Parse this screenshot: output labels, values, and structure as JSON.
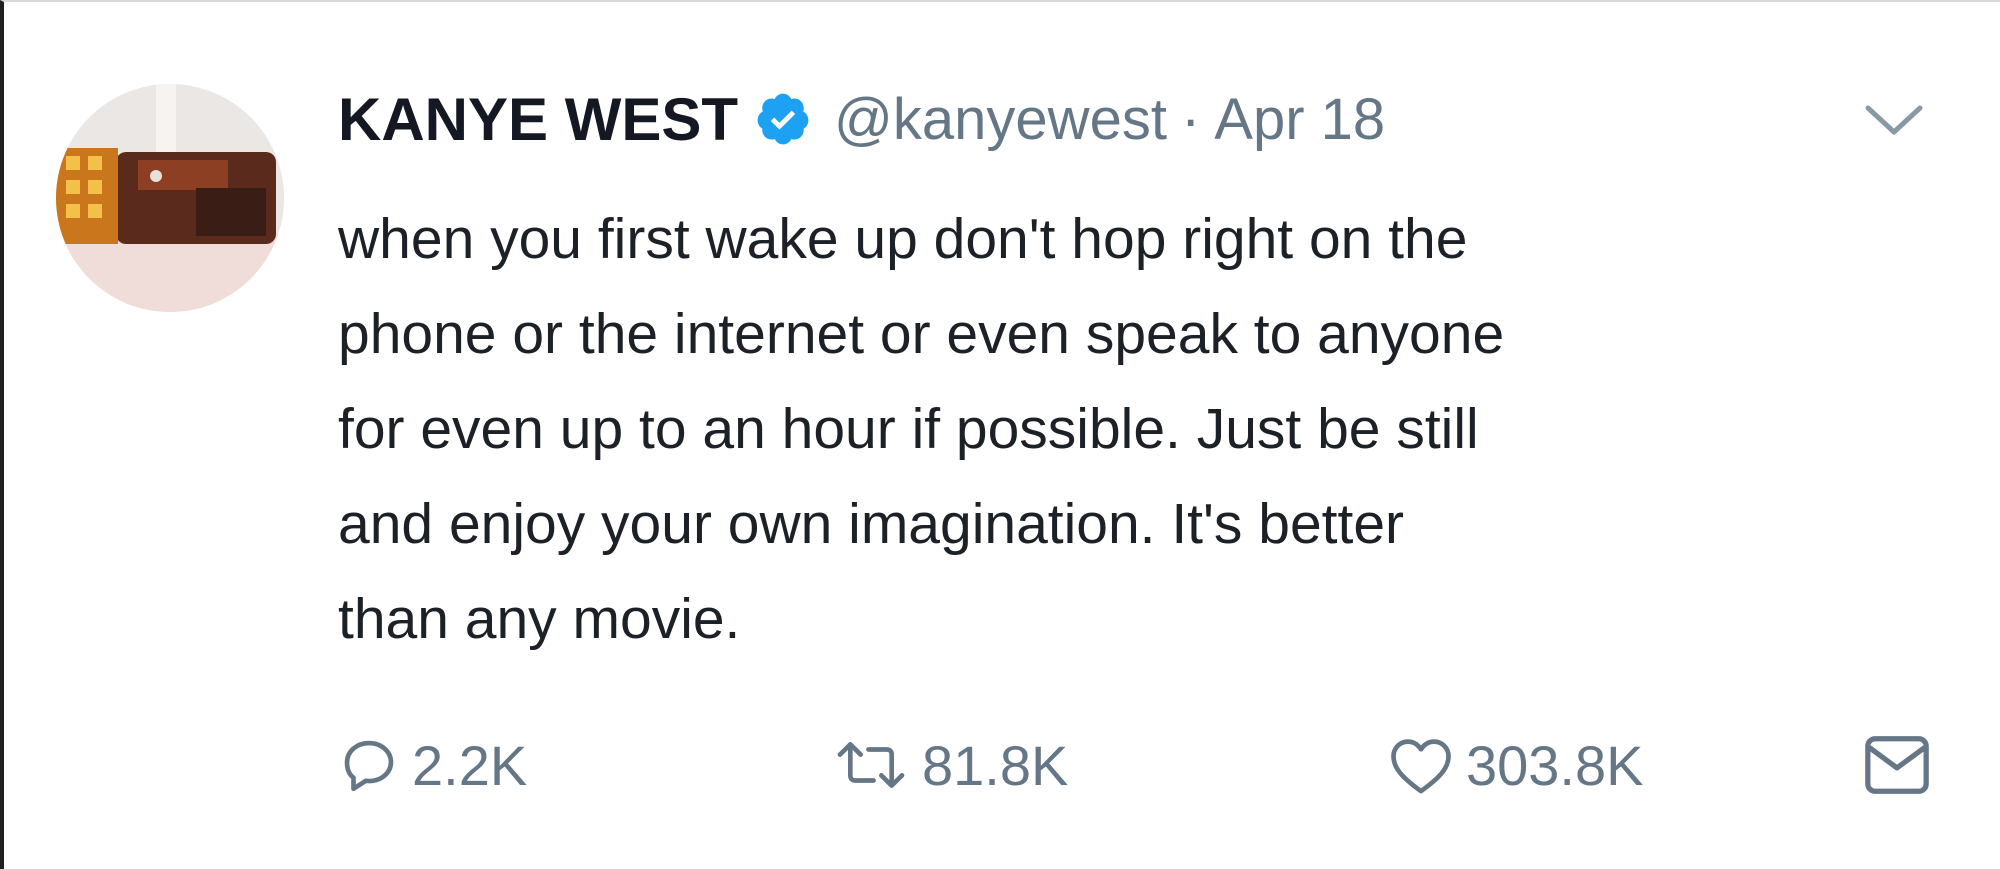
{
  "tweet": {
    "author_name": "KANYE WEST",
    "verified_icon": "verified-badge-icon",
    "handle": "@kanyewest",
    "separator": "·",
    "date": "Apr 18",
    "text_lines": [
      "when you first wake up don't hop right on the",
      "phone or the internet or even speak to anyone",
      "for even up to an hour if possible. Just be still",
      "and enjoy your own imagination. It's better",
      "than any movie."
    ]
  },
  "actions": {
    "reply": {
      "icon": "reply-icon",
      "count": "2.2K"
    },
    "retweet": {
      "icon": "retweet-icon",
      "count": "81.8K"
    },
    "like": {
      "icon": "heart-icon",
      "count": "303.8K"
    },
    "dm": {
      "icon": "envelope-icon"
    }
  },
  "colors": {
    "verified_blue": "#1da1f2",
    "secondary_text": "#657786",
    "primary_text": "#141823"
  }
}
